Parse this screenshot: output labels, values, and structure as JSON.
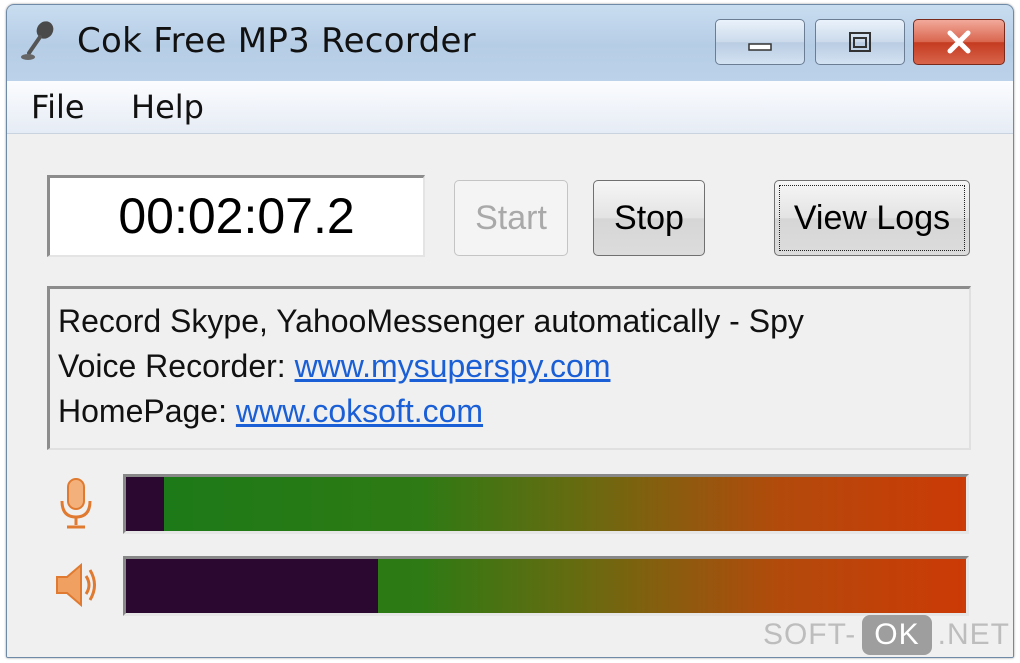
{
  "window": {
    "title": "Cok Free MP3 Recorder",
    "icon": "microphone-icon"
  },
  "menu": {
    "items": [
      "File",
      "Help"
    ]
  },
  "timer": {
    "value": "00:02:07.2"
  },
  "buttons": {
    "start_label": "Start",
    "stop_label": "Stop",
    "view_logs_label": "View Logs"
  },
  "info": {
    "line1": "Record Skype, YahooMessenger automatically - Spy",
    "line2_prefix": "Voice Recorder: ",
    "line2_link": "www.mysuperspy.com",
    "line3_prefix": "HomePage: ",
    "line3_link": "www.coksoft.com"
  },
  "meters": {
    "microphone_level": 0.955,
    "speaker_level": 0.7
  },
  "watermark": {
    "left": "SOFT-",
    "badge": "OK",
    "right": ".NET"
  },
  "colors": {
    "link": "#1a5fd6",
    "meter_low": "#1a7a18",
    "meter_high": "#cc3a06",
    "meter_empty": "#2a0830",
    "icon_orange": "#e07a30"
  }
}
